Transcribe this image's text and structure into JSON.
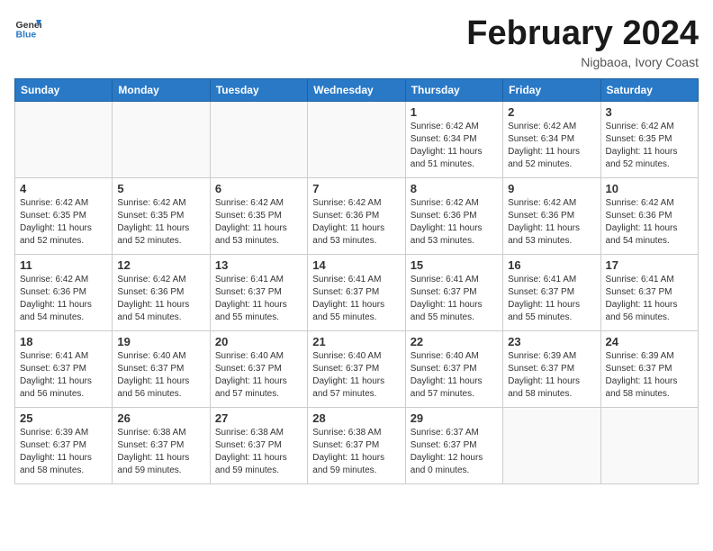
{
  "logo": {
    "line1": "General",
    "line2": "Blue"
  },
  "title": "February 2024",
  "subtitle": "Nigbaoa, Ivory Coast",
  "headers": [
    "Sunday",
    "Monday",
    "Tuesday",
    "Wednesday",
    "Thursday",
    "Friday",
    "Saturday"
  ],
  "weeks": [
    [
      {
        "date": "",
        "info": ""
      },
      {
        "date": "",
        "info": ""
      },
      {
        "date": "",
        "info": ""
      },
      {
        "date": "",
        "info": ""
      },
      {
        "date": "1",
        "info": "Sunrise: 6:42 AM\nSunset: 6:34 PM\nDaylight: 11 hours\nand 51 minutes."
      },
      {
        "date": "2",
        "info": "Sunrise: 6:42 AM\nSunset: 6:34 PM\nDaylight: 11 hours\nand 52 minutes."
      },
      {
        "date": "3",
        "info": "Sunrise: 6:42 AM\nSunset: 6:35 PM\nDaylight: 11 hours\nand 52 minutes."
      }
    ],
    [
      {
        "date": "4",
        "info": "Sunrise: 6:42 AM\nSunset: 6:35 PM\nDaylight: 11 hours\nand 52 minutes."
      },
      {
        "date": "5",
        "info": "Sunrise: 6:42 AM\nSunset: 6:35 PM\nDaylight: 11 hours\nand 52 minutes."
      },
      {
        "date": "6",
        "info": "Sunrise: 6:42 AM\nSunset: 6:35 PM\nDaylight: 11 hours\nand 53 minutes."
      },
      {
        "date": "7",
        "info": "Sunrise: 6:42 AM\nSunset: 6:36 PM\nDaylight: 11 hours\nand 53 minutes."
      },
      {
        "date": "8",
        "info": "Sunrise: 6:42 AM\nSunset: 6:36 PM\nDaylight: 11 hours\nand 53 minutes."
      },
      {
        "date": "9",
        "info": "Sunrise: 6:42 AM\nSunset: 6:36 PM\nDaylight: 11 hours\nand 53 minutes."
      },
      {
        "date": "10",
        "info": "Sunrise: 6:42 AM\nSunset: 6:36 PM\nDaylight: 11 hours\nand 54 minutes."
      }
    ],
    [
      {
        "date": "11",
        "info": "Sunrise: 6:42 AM\nSunset: 6:36 PM\nDaylight: 11 hours\nand 54 minutes."
      },
      {
        "date": "12",
        "info": "Sunrise: 6:42 AM\nSunset: 6:36 PM\nDaylight: 11 hours\nand 54 minutes."
      },
      {
        "date": "13",
        "info": "Sunrise: 6:41 AM\nSunset: 6:37 PM\nDaylight: 11 hours\nand 55 minutes."
      },
      {
        "date": "14",
        "info": "Sunrise: 6:41 AM\nSunset: 6:37 PM\nDaylight: 11 hours\nand 55 minutes."
      },
      {
        "date": "15",
        "info": "Sunrise: 6:41 AM\nSunset: 6:37 PM\nDaylight: 11 hours\nand 55 minutes."
      },
      {
        "date": "16",
        "info": "Sunrise: 6:41 AM\nSunset: 6:37 PM\nDaylight: 11 hours\nand 55 minutes."
      },
      {
        "date": "17",
        "info": "Sunrise: 6:41 AM\nSunset: 6:37 PM\nDaylight: 11 hours\nand 56 minutes."
      }
    ],
    [
      {
        "date": "18",
        "info": "Sunrise: 6:41 AM\nSunset: 6:37 PM\nDaylight: 11 hours\nand 56 minutes."
      },
      {
        "date": "19",
        "info": "Sunrise: 6:40 AM\nSunset: 6:37 PM\nDaylight: 11 hours\nand 56 minutes."
      },
      {
        "date": "20",
        "info": "Sunrise: 6:40 AM\nSunset: 6:37 PM\nDaylight: 11 hours\nand 57 minutes."
      },
      {
        "date": "21",
        "info": "Sunrise: 6:40 AM\nSunset: 6:37 PM\nDaylight: 11 hours\nand 57 minutes."
      },
      {
        "date": "22",
        "info": "Sunrise: 6:40 AM\nSunset: 6:37 PM\nDaylight: 11 hours\nand 57 minutes."
      },
      {
        "date": "23",
        "info": "Sunrise: 6:39 AM\nSunset: 6:37 PM\nDaylight: 11 hours\nand 58 minutes."
      },
      {
        "date": "24",
        "info": "Sunrise: 6:39 AM\nSunset: 6:37 PM\nDaylight: 11 hours\nand 58 minutes."
      }
    ],
    [
      {
        "date": "25",
        "info": "Sunrise: 6:39 AM\nSunset: 6:37 PM\nDaylight: 11 hours\nand 58 minutes."
      },
      {
        "date": "26",
        "info": "Sunrise: 6:38 AM\nSunset: 6:37 PM\nDaylight: 11 hours\nand 59 minutes."
      },
      {
        "date": "27",
        "info": "Sunrise: 6:38 AM\nSunset: 6:37 PM\nDaylight: 11 hours\nand 59 minutes."
      },
      {
        "date": "28",
        "info": "Sunrise: 6:38 AM\nSunset: 6:37 PM\nDaylight: 11 hours\nand 59 minutes."
      },
      {
        "date": "29",
        "info": "Sunrise: 6:37 AM\nSunset: 6:37 PM\nDaylight: 12 hours\nand 0 minutes."
      },
      {
        "date": "",
        "info": ""
      },
      {
        "date": "",
        "info": ""
      }
    ]
  ]
}
